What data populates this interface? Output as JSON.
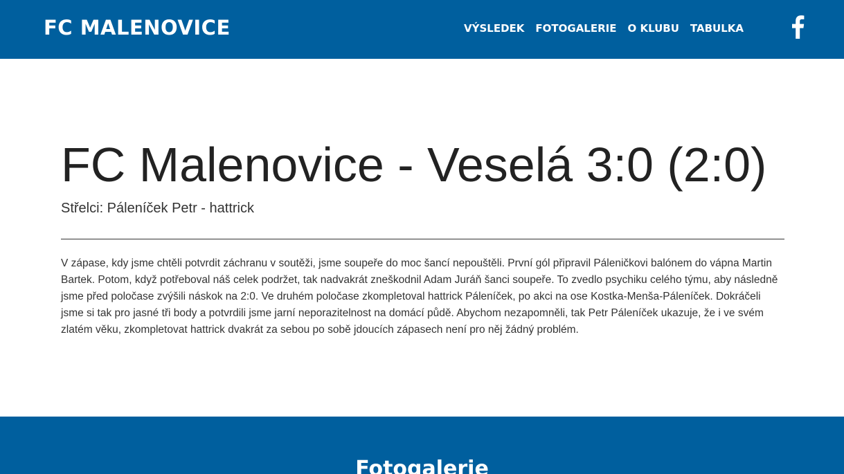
{
  "header": {
    "brand": "FC MALENOVICE",
    "nav": [
      {
        "label": "VÝSLEDEK"
      },
      {
        "label": "FOTOGALERIE"
      },
      {
        "label": "O KLUBU"
      },
      {
        "label": "TABULKA"
      }
    ],
    "social_icon": "facebook-icon"
  },
  "match": {
    "title": "FC Malenovice - Veselá 3:0 (2:0)",
    "scorers": "Střelci: Páleníček Petr - hattrick",
    "report": "V zápase, kdy jsme chtěli potvrdit záchranu v soutěži, jsme soupeře do moc šancí nepouštěli. První gól připravil Páleničkovi balónem do vápna Martin Bartek. Potom, když potřeboval náš celek podržet, tak nadvakrát zneškodnil Adam Juráň šanci soupeře. To zvedlo psychiku celého týmu, aby následně jsme před poločase zvýšili náskok na 2:0. Ve druhém poločase zkompletoval hattrick Páleníček, po akci na ose Kostka-Menša-Páleníček. Dokráčeli jsme si tak pro jasné tři body a potvrdili jsme jarní neporazitelnost na domácí půdě. Abychom nezapomněli, tak Petr Páleníček ukazuje, že i ve svém zlatém věku, zkompletovat hattrick dvakrát za sebou po sobě jdoucích zápasech není pro něj žádný problém."
  },
  "gallery": {
    "title": "Fotogalerie"
  },
  "colors": {
    "brand_blue": "#005f9e",
    "text": "#222222",
    "white": "#ffffff"
  }
}
